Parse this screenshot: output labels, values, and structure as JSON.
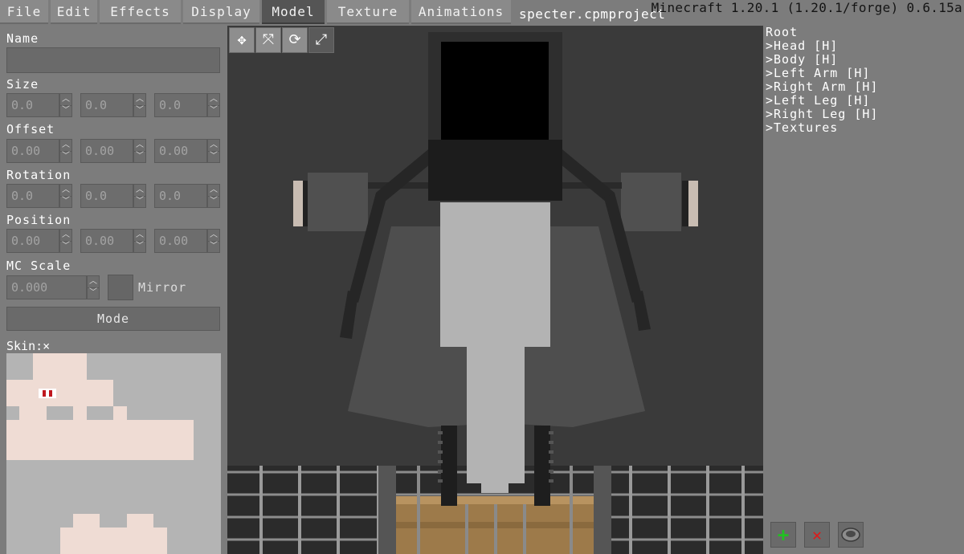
{
  "menu": {
    "items": [
      "File",
      "Edit",
      "Effects",
      "Display",
      "Model",
      "Texture",
      "Animations"
    ],
    "active": "Model"
  },
  "window": {
    "project_file": "specter.cpmproject",
    "version": "Minecraft 1.20.1 (1.20.1/forge) 0.6.15a"
  },
  "properties": {
    "name_label": "Name",
    "name_value": "",
    "size": {
      "label": "Size",
      "x": "0.0",
      "y": "0.0",
      "z": "0.0"
    },
    "offset": {
      "label": "Offset",
      "x": "0.00",
      "y": "0.00",
      "z": "0.00"
    },
    "rotation": {
      "label": "Rotation",
      "x": "0.0",
      "y": "0.0",
      "z": "0.0"
    },
    "position": {
      "label": "Position",
      "x": "0.00",
      "y": "0.00",
      "z": "0.00"
    },
    "mc_scale": {
      "label": "MC Scale",
      "value": "0.000"
    },
    "mirror_label": "Mirror",
    "mode_label": "Mode",
    "skin_label": "Skin:×"
  },
  "tools": [
    {
      "name": "move-tool",
      "glyph": "✥"
    },
    {
      "name": "size-tool",
      "glyph": "⤧"
    },
    {
      "name": "rotate-tool",
      "glyph": "⟳"
    },
    {
      "name": "scale-tool",
      "glyph": "⤢",
      "active": true
    }
  ],
  "tree": {
    "root": "Root",
    "items": [
      ">Head [H]",
      ">Body [H]",
      ">Left Arm [H]",
      ">Right Arm [H]",
      ">Left Leg [H]",
      ">Right Leg [H]",
      ">Textures"
    ]
  },
  "actions": {
    "add_glyph": "+",
    "delete_glyph": "✕",
    "toggle_icon": "eye-icon"
  },
  "colors": {
    "panel": "#7c7c7c",
    "active_tab": "#555555",
    "viewport": "#3a3a3a",
    "add": "#22c022",
    "delete": "#e01818",
    "skin_tone": "#efdcd4"
  }
}
